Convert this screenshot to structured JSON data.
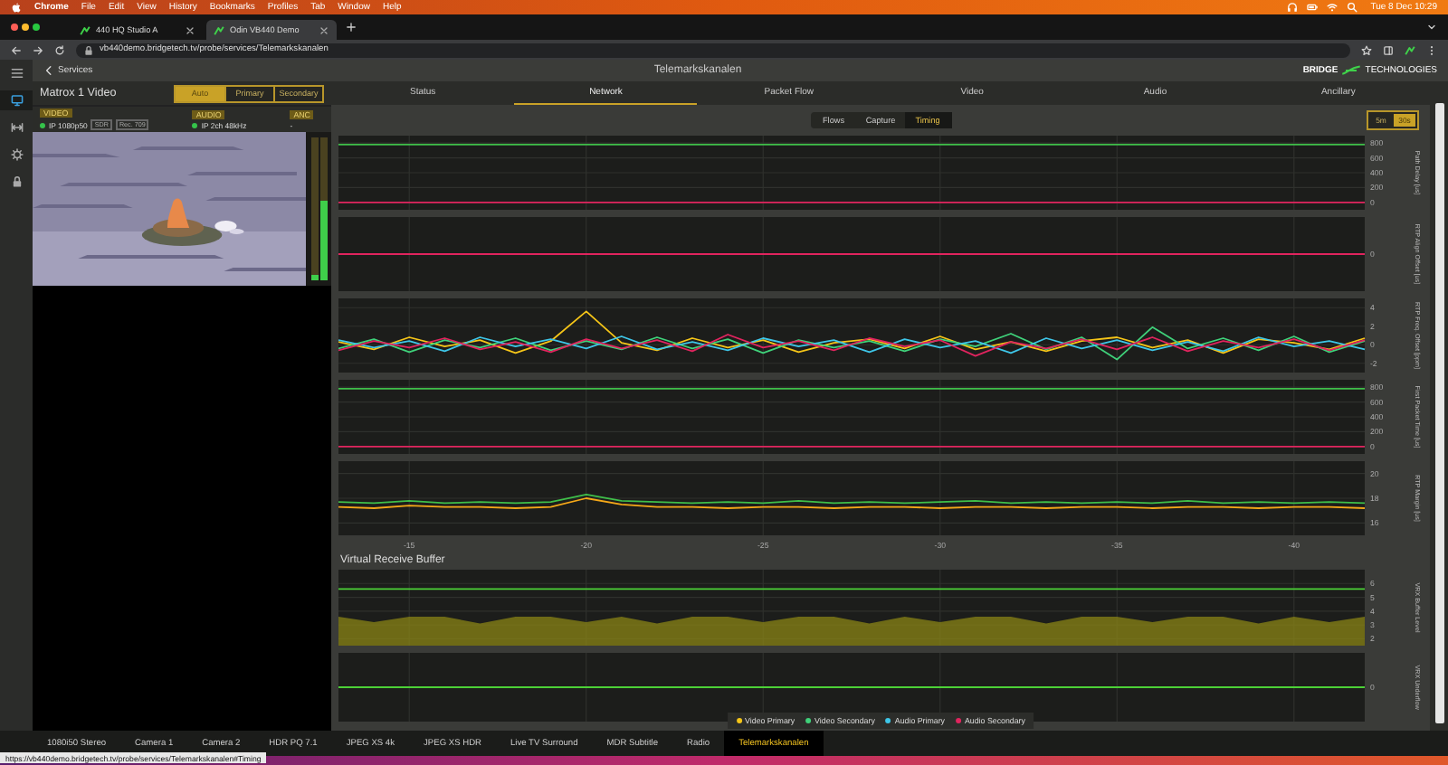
{
  "menubar": {
    "app": "Chrome",
    "menus": [
      "File",
      "Edit",
      "View",
      "History",
      "Bookmarks",
      "Profiles",
      "Tab",
      "Window",
      "Help"
    ],
    "clock": "Tue 8 Dec  10:29"
  },
  "browser_tabs": [
    {
      "title": "440 HQ Studio A",
      "selected": false
    },
    {
      "title": "Odin VB440 Demo",
      "selected": true
    }
  ],
  "address": "vb440demo.bridgetech.tv/probe/services/Telemarkskanalen",
  "app_header": {
    "back": "Services",
    "title": "Telemarkskanalen",
    "logo_left": "BRIDGE",
    "logo_right": "TECHNOLOGIES"
  },
  "sidebar": [
    {
      "kind": "menu",
      "selected": false
    },
    {
      "kind": "monitor",
      "selected": true
    },
    {
      "kind": "arrows",
      "selected": false
    },
    {
      "kind": "gear",
      "selected": false
    },
    {
      "kind": "lock",
      "selected": false
    }
  ],
  "source": {
    "title": "Matrox 1 Video",
    "modes": [
      {
        "label": "Auto",
        "selected": true
      },
      {
        "label": "Primary",
        "selected": false
      },
      {
        "label": "Secondary",
        "selected": false
      }
    ],
    "streams": [
      {
        "heading": "VIDEO",
        "value": "IP 1080p50",
        "color": "#35c24a",
        "tags": [
          "SDR",
          "Rec. 709"
        ]
      },
      {
        "heading": "AUDIO",
        "value": "IP 2ch 48kHz",
        "color": "#35c24a"
      },
      {
        "heading": "ANC",
        "value": "-"
      }
    ],
    "meters": [
      {
        "level": 0.04
      },
      {
        "level": 0.56
      }
    ]
  },
  "main_tabs": [
    {
      "label": "Status",
      "selected": false
    },
    {
      "label": "Network",
      "selected": true
    },
    {
      "label": "Packet Flow",
      "selected": false
    },
    {
      "label": "Video",
      "selected": false
    },
    {
      "label": "Audio",
      "selected": false
    },
    {
      "label": "Ancillary",
      "selected": false
    }
  ],
  "sub_tabs": [
    {
      "label": "Flows",
      "selected": false
    },
    {
      "label": "Capture",
      "selected": false
    },
    {
      "label": "Timing",
      "selected": true
    }
  ],
  "range_buttons": [
    {
      "label": "5m",
      "selected": false
    },
    {
      "label": "30s",
      "selected": true
    }
  ],
  "timing_charts": [
    {
      "chart_data": {
        "type": "line",
        "ylabel": "Path Delay [us]",
        "grid": true,
        "x": [
          -13,
          -42
        ],
        "xlim": [
          -13,
          -42
        ],
        "ylim": [
          -100,
          900
        ],
        "yticks": [
          800,
          600,
          400,
          200,
          0
        ],
        "series": [
          {
            "color": "#3fbf4a",
            "values": [
              780,
              780
            ]
          },
          {
            "color": "#e0245e",
            "values": [
              0,
              0
            ]
          }
        ]
      }
    },
    {
      "ylabel": "RTP Align Offset [us]",
      "tick_label": "0",
      "color": "#e0245e"
    },
    {
      "chart_data": {
        "type": "line",
        "ylabel": "RTP Freq. Offset [ppm]",
        "grid": true,
        "x": [
          -13,
          -14,
          -15,
          -16,
          -17,
          -18,
          -19,
          -20,
          -21,
          -22,
          -23,
          -24,
          -25,
          -26,
          -27,
          -28,
          -29,
          -30,
          -31,
          -32,
          -33,
          -34,
          -35,
          -36,
          -37,
          -38,
          -39,
          -40,
          -41,
          -42
        ],
        "xlim": [
          -13,
          -42
        ],
        "ylim": [
          -3,
          5
        ],
        "yticks": [
          4,
          2,
          0,
          -2
        ],
        "series": [
          {
            "color": "#f5c518",
            "values": [
              0.3,
              -0.5,
              0.8,
              -0.2,
              0.5,
              -0.9,
              0.4,
              3.6,
              0.2,
              -0.6,
              0.7,
              -0.3,
              0.5,
              -0.8,
              0.2,
              0.6,
              -0.4,
              0.9,
              -0.5,
              0.3,
              -0.7,
              0.4,
              0.8,
              -0.3,
              0.5,
              -0.9,
              0.6,
              0.2,
              -0.5,
              0.7
            ]
          },
          {
            "color": "#3fd17a",
            "values": [
              -0.4,
              0.6,
              -0.8,
              0.5,
              -0.3,
              0.7,
              -0.6,
              0.4,
              -0.5,
              0.8,
              -0.4,
              0.6,
              -0.9,
              0.5,
              -0.3,
              0.4,
              -0.7,
              0.6,
              -0.2,
              1.2,
              -0.5,
              0.8,
              -1.6,
              1.9,
              -0.4,
              0.7,
              -0.6,
              0.9,
              -0.8,
              0.4
            ]
          },
          {
            "color": "#3ec6e8",
            "values": [
              0.5,
              -0.3,
              0.4,
              -0.7,
              0.8,
              -0.2,
              0.6,
              -0.4,
              0.9,
              -0.5,
              0.3,
              -0.6,
              0.7,
              -0.2,
              0.5,
              -0.8,
              0.6,
              -0.3,
              0.4,
              -0.9,
              0.7,
              -0.4,
              0.5,
              -0.6,
              0.3,
              -0.7,
              0.8,
              -0.2,
              0.4,
              -0.5
            ]
          },
          {
            "color": "#e0245e",
            "values": [
              -0.6,
              0.4,
              -0.3,
              0.7,
              -0.5,
              0.3,
              -0.8,
              0.6,
              -0.4,
              0.5,
              -0.7,
              1.1,
              -0.3,
              0.4,
              -0.6,
              0.7,
              -0.2,
              0.5,
              -1.2,
              0.3,
              -0.4,
              0.6,
              -0.5,
              0.8,
              -0.7,
              0.4,
              -0.3,
              0.6,
              -0.6,
              0.5
            ]
          }
        ]
      }
    },
    {
      "chart_data": {
        "type": "line",
        "ylabel": "First Packet Time [us]",
        "grid": true,
        "x": [
          -13,
          -42
        ],
        "xlim": [
          -13,
          -42
        ],
        "ylim": [
          -100,
          900
        ],
        "yticks": [
          800,
          600,
          400,
          200,
          0
        ],
        "series": [
          {
            "color": "#3fbf4a",
            "values": [
              780,
              780
            ]
          },
          {
            "color": "#e0245e",
            "values": [
              0,
              0
            ]
          }
        ]
      }
    },
    {
      "chart_data": {
        "type": "line",
        "ylabel": "RTP Margin [us]",
        "grid": true,
        "x": [
          -13,
          -14,
          -15,
          -16,
          -17,
          -18,
          -19,
          -20,
          -21,
          -22,
          -23,
          -24,
          -25,
          -26,
          -27,
          -28,
          -29,
          -30,
          -31,
          -32,
          -33,
          -34,
          -35,
          -36,
          -37,
          -38,
          -39,
          -40,
          -41,
          -42
        ],
        "xlim": [
          -13,
          -42
        ],
        "ylim": [
          15,
          21
        ],
        "xticks": [
          -15,
          -20,
          -25,
          -30,
          -35,
          -40
        ],
        "yticks": [
          20,
          18,
          16
        ],
        "series": [
          {
            "color": "#3fbf4a",
            "values": [
              17.7,
              17.6,
              17.8,
              17.6,
              17.7,
              17.6,
              17.7,
              18.3,
              17.8,
              17.7,
              17.6,
              17.7,
              17.6,
              17.8,
              17.6,
              17.7,
              17.6,
              17.7,
              17.8,
              17.6,
              17.7,
              17.6,
              17.7,
              17.6,
              17.8,
              17.6,
              17.7,
              17.6,
              17.7,
              17.6
            ]
          },
          {
            "color": "#f5a818",
            "values": [
              17.3,
              17.2,
              17.4,
              17.3,
              17.3,
              17.2,
              17.3,
              18.0,
              17.5,
              17.3,
              17.3,
              17.2,
              17.3,
              17.3,
              17.2,
              17.3,
              17.3,
              17.2,
              17.3,
              17.3,
              17.2,
              17.3,
              17.3,
              17.2,
              17.3,
              17.3,
              17.2,
              17.3,
              17.3,
              17.2
            ]
          }
        ]
      }
    }
  ],
  "buffer_section": {
    "title": "Virtual Receive Buffer",
    "charts": [
      {
        "chart_data": {
          "type": "area",
          "ylabel": "VRX Buffer Level",
          "grid": true,
          "x": [
            -13,
            -14,
            -15,
            -16,
            -17,
            -18,
            -19,
            -20,
            -21,
            -22,
            -23,
            -24,
            -25,
            -26,
            -27,
            -28,
            -29,
            -30,
            -31,
            -32,
            -33,
            -34,
            -35,
            -36,
            -37,
            -38,
            -39,
            -40,
            -41,
            -42
          ],
          "xlim": [
            -13,
            -42
          ],
          "ylim": [
            1.5,
            7
          ],
          "yticks": [
            6,
            5,
            4,
            3,
            2
          ],
          "series": [
            {
              "color": "#8a8416",
              "values": [
                3.6,
                3.2,
                3.6,
                3.6,
                3.1,
                3.6,
                3.6,
                3.2,
                3.6,
                3.1,
                3.6,
                3.6,
                3.2,
                3.6,
                3.6,
                3.1,
                3.6,
                3.2,
                3.6,
                3.6,
                3.1,
                3.6,
                3.6,
                3.2,
                3.6,
                3.6,
                3.1,
                3.6,
                3.2,
                3.6
              ]
            },
            {
              "type": "line",
              "color": "#4cd137",
              "values": [
                5.6,
                5.6,
                5.6,
                5.6,
                5.6,
                5.6,
                5.6,
                5.6,
                5.6,
                5.6,
                5.6,
                5.6,
                5.6,
                5.6,
                5.6,
                5.6,
                5.6,
                5.6,
                5.6,
                5.6,
                5.6,
                5.6,
                5.6,
                5.6,
                5.6,
                5.6,
                5.6,
                5.6,
                5.6,
                5.6
              ]
            }
          ]
        }
      },
      {
        "ylabel": "VRX Underflow",
        "tick_label": "0",
        "color": "#4cd137"
      }
    ]
  },
  "legend": [
    {
      "label": "Video Primary",
      "color": "#f5c518"
    },
    {
      "label": "Video Secondary",
      "color": "#3fd17a"
    },
    {
      "label": "Audio Primary",
      "color": "#3ec6e8"
    },
    {
      "label": "Audio Secondary",
      "color": "#e0245e"
    }
  ],
  "bottom_tabs": [
    {
      "label": "1080i50 Stereo",
      "selected": false
    },
    {
      "label": "Camera 1",
      "selected": false
    },
    {
      "label": "Camera 2",
      "selected": false
    },
    {
      "label": "HDR PQ 7.1",
      "selected": false
    },
    {
      "label": "JPEG XS 4k",
      "selected": false
    },
    {
      "label": "JPEG XS HDR",
      "selected": false
    },
    {
      "label": "Live TV Surround",
      "selected": false
    },
    {
      "label": "MDR Subtitle",
      "selected": false
    },
    {
      "label": "Radio",
      "selected": false
    },
    {
      "label": "Telemarkskanalen",
      "selected": true
    }
  ],
  "status_url": "https://vb440demo.bridgetech.tv/probe/services/Telemarkskanalen#Timing"
}
